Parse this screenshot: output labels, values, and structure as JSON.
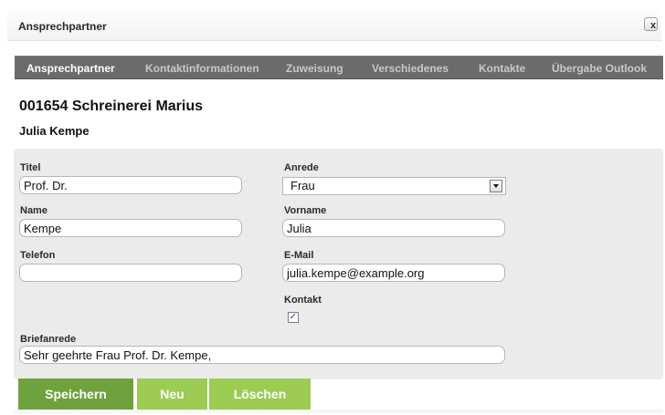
{
  "dialog": {
    "title": "Ansprechpartner",
    "close_label": "x"
  },
  "tabs": [
    {
      "label": "Ansprechpartner",
      "active": true
    },
    {
      "label": "Kontaktinformationen",
      "active": false
    },
    {
      "label": "Zuweisung",
      "active": false
    },
    {
      "label": "Verschiedenes",
      "active": false
    },
    {
      "label": "Kontakte",
      "active": false
    },
    {
      "label": "Übergabe Outlook",
      "active": false
    }
  ],
  "record": {
    "title": "001654 Schreinerei Marius",
    "person_name": "Julia  Kempe"
  },
  "form": {
    "title_label": "Titel",
    "title_value": "Prof. Dr.",
    "salutation_label": "Anrede",
    "salutation_value": "Frau",
    "name_label": "Name",
    "name_value": "Kempe",
    "first_name_label": "Vorname",
    "first_name_value": "Julia",
    "phone_label": "Telefon",
    "phone_value": "",
    "email_label": "E-Mail",
    "email_value": "julia.kempe@example.org",
    "contact_label": "Kontakt",
    "contact_checked": true,
    "letter_salutation_label": "Briefanrede",
    "letter_salutation_value": "Sehr geehrte Frau Prof. Dr. Kempe,"
  },
  "buttons": {
    "save": "Speichern",
    "new": "Neu",
    "delete": "Löschen"
  },
  "icons": {
    "close": "close-icon",
    "dropdown": "chevron-down-icon",
    "checkbox": "checkmark-icon"
  },
  "colors": {
    "tab_bar": "#6b6b6b",
    "save_button": "#6fa23d",
    "secondary_button": "#9ccc52",
    "panel": "#ebebeb"
  }
}
